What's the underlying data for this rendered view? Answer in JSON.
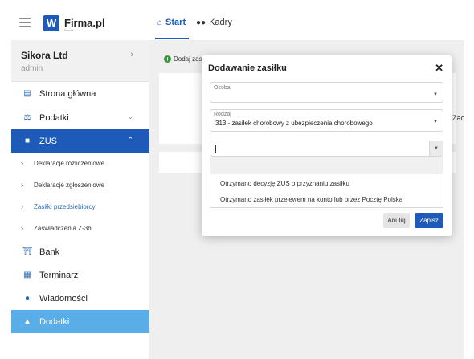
{
  "brand": {
    "logo_letter": "W",
    "name": "Firma.pl",
    "sub": "Biznes"
  },
  "tabs": [
    {
      "label": "Start",
      "icon": "home-icon"
    },
    {
      "label": "Kadry",
      "icon": "users-icon"
    }
  ],
  "company": {
    "name": "Sikora Ltd",
    "user": "admin"
  },
  "sidebar": {
    "items": [
      {
        "label": "Strona główna",
        "icon": "dashboard-icon"
      },
      {
        "label": "Podatki",
        "icon": "scale-icon"
      },
      {
        "label": "ZUS",
        "icon": "zus-icon"
      },
      {
        "label": "Bank",
        "icon": "bank-icon"
      },
      {
        "label": "Terminarz",
        "icon": "calendar-icon"
      },
      {
        "label": "Wiadomości",
        "icon": "chat-icon"
      },
      {
        "label": "Dodatki",
        "icon": "puzzle-icon"
      }
    ],
    "zus_sub": [
      "Deklaracje rozliczeniowe",
      "Deklaracje zgłoszeniowe",
      "Zasiłki przedsiębiorcy",
      "Zaświadczenia Z-3b"
    ]
  },
  "main": {
    "add_label": "Dodaj zas",
    "peek_text": "Zac"
  },
  "modal": {
    "title": "Dodawanie zasiłku",
    "osoba_label": "Osoba",
    "osoba_value": "",
    "rodzaj_label": "Rodzaj",
    "rodzaj_value": "313 - zasiłek chorobowy z ubezpieczenia chorobowego",
    "search_value": "",
    "options": [
      "Otrzymano decyzję ZUS o przyznaniu zasiłku",
      "Otrzymano zasiłek przelewem na konto lub przez Pocztę Polską"
    ],
    "cancel_label": "Anuluj",
    "save_label": "Zapisz"
  },
  "colors": {
    "primary": "#1e5bb8",
    "highlight": "#5aaee8",
    "background": "#efefef"
  }
}
